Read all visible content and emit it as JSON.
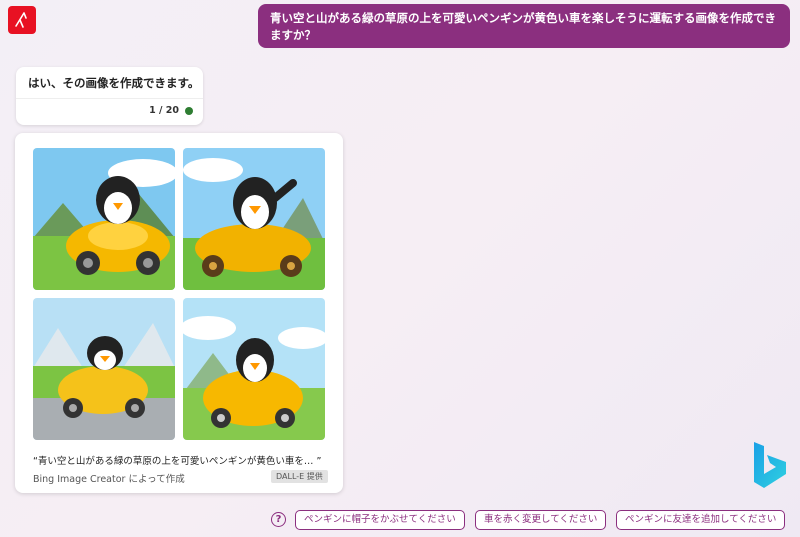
{
  "user_message": "青い空と山がある緑の草原の上を可愛いペンギンが黄色い車を楽しそうに運転する画像を作成できますか？",
  "bot_message": {
    "text": "はい、その画像を作成できます。",
    "counter": "1 / 20"
  },
  "gallery": {
    "caption": "“青い空と山がある緑の草原の上を可愛いペンギンが黄色い車を… ”",
    "creator": "Bing Image Creator によって作成",
    "badge": "DALL-E 提供",
    "images": [
      {
        "alt": "penguin-in-yellow-car-1"
      },
      {
        "alt": "penguin-in-yellow-car-2"
      },
      {
        "alt": "penguin-in-yellow-car-3"
      },
      {
        "alt": "penguin-in-yellow-car-4"
      }
    ]
  },
  "suggestions": [
    "ペンギンに帽子をかぶせてください",
    "車を赤く変更してください",
    "ペンギンに友達を追加してください"
  ],
  "colors": {
    "accent": "#8b2f7f",
    "avatar": "#e81123",
    "status_dot": "#2e7d32"
  },
  "icons": {
    "avatar": "user-avatar-icon",
    "help": "help-icon",
    "bing": "bing-logo-icon"
  }
}
